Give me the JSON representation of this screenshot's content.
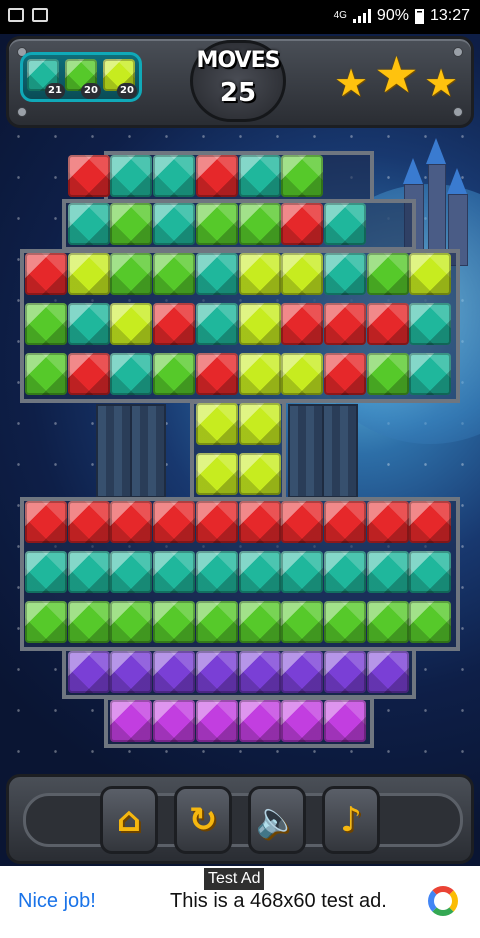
{
  "status_bar": {
    "network": "4G",
    "battery": "90%",
    "time": "13:27"
  },
  "header": {
    "moves_label": "MOVES",
    "moves_value": "25",
    "goals": [
      {
        "color": "teal",
        "count": "21"
      },
      {
        "color": "green",
        "count": "20"
      },
      {
        "color": "lime",
        "count": "20"
      }
    ],
    "stars_earned": 3
  },
  "board": {
    "rows": [
      ".RTTRTG...",
      ".TGTGGRT..",
      "RLGGTLLTGL",
      "GTLRTLRRRT",
      "GRTGRLLRGT",
      "....LL....",
      "....LL....",
      "RRRRRRRRRR",
      "TTTTTTTTTT",
      "GGGGGGGGGG",
      ".PPPPPPPP.",
      "..MMMMMM.."
    ],
    "legend": {
      "R": "red",
      "T": "teal",
      "G": "green",
      "L": "lime",
      "P": "purple",
      "M": "magenta"
    }
  },
  "controls": [
    {
      "name": "home-button",
      "icon": "home-icon",
      "glyph": "⌂"
    },
    {
      "name": "restart-button",
      "icon": "restart-icon",
      "glyph": "↻"
    },
    {
      "name": "sound-button",
      "icon": "speaker-icon",
      "glyph": "🔈"
    },
    {
      "name": "music-button",
      "icon": "music-note-icon",
      "glyph": "♪"
    }
  ],
  "ad": {
    "tag": "Test Ad",
    "title": "Nice job!",
    "text": "This is a 468x60 test ad."
  }
}
